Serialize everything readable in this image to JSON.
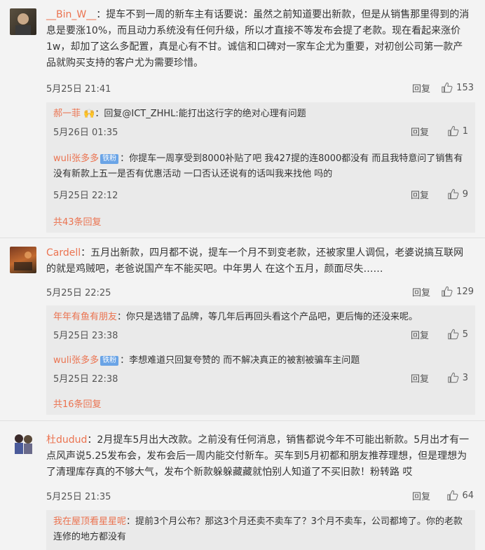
{
  "comments": [
    {
      "user": "__Bin_W__",
      "sep": "：",
      "text": "提车不到一周的新车主有话要说：虽然之前知道要出新款，但是从销售那里得到的消息是要涨10%，而且动力系统没有任何升级，所以才直接不等发布会提了老款。现在看起来涨价1w，却加了这么多配置，真是心有不甘。诚信和口碑对一家车企尤为重要，对初创公司第一款产品就购买支持的客户尤为需要珍惜。",
      "date": "5月25日 21:41",
      "reply_label": "回复",
      "likes": "153",
      "replies": [
        {
          "user": "郝一菲",
          "emoji": "🙌",
          "sep": "：",
          "text": "回复@ICT_ZHHL:能打出这行字的绝对心理有问题",
          "date": "5月26日 01:35",
          "reply_label": "回复",
          "likes": "1"
        },
        {
          "user": "wuli张多多",
          "badge": "铁粉",
          "sep": "：",
          "text": "你提车一周享受到8000补贴了吧 我427提的连8000都没有 而且我特意问了销售有没有新款上五一是否有优惠活动 一口否认还说有的话叫我来找他 吗的",
          "date": "5月25日 22:12",
          "reply_label": "回复",
          "likes": "9"
        }
      ],
      "more": "共43条回复"
    },
    {
      "user": "Cardell",
      "sep": "：",
      "text": "五月出新款，四月都不说，提车一个月不到变老款，还被家里人调侃，老婆说搞互联网的就是鸡贼吧，老爸说国产车不能买吧。中年男人 在这个五月，颜面尽失……",
      "date": "5月25日 22:25",
      "reply_label": "回复",
      "likes": "129",
      "replies": [
        {
          "user": "年年有鱼有朋友",
          "sep": "：",
          "text": "你只是选错了品牌，等几年后再回头看这个产品吧，更后悔的还没来呢。",
          "date": "5月25日 23:38",
          "reply_label": "回复",
          "likes": "5"
        },
        {
          "user": "wuli张多多",
          "badge": "铁粉",
          "sep": "：",
          "text": "李想难道只回复夸赞的 而不解决真正的被割被骗车主问题",
          "date": "5月25日 22:38",
          "reply_label": "回复",
          "likes": "3"
        }
      ],
      "more": "共16条回复"
    },
    {
      "user": "杜dudud",
      "sep": "：",
      "text": "2月提车5月出大改款。之前没有任何消息，销售都说今年不可能出新款。5月出才有一点风声说5.25发布会，发布会后一周内能交付新车。买车到5月初都和朋友推荐理想，但是理想为了清理库存真的不够大气，发布个新款躲躲藏藏就怕别人知道了不买旧款！粉转路 哎",
      "date": "5月25日 21:35",
      "reply_label": "回复",
      "likes": "64",
      "replies": [
        {
          "user": "我在屋顶看星星呢",
          "sep": "：",
          "text": "提前3个月公布？那这3个月还卖不卖车了？3个月不卖车，公司都垮了。你的老款连修的地方都没有"
        }
      ]
    }
  ],
  "colors": {
    "username": "#eb7350",
    "badge": "#6aa4e6",
    "reply_bg": "#eaeaea",
    "page_bg": "#f3f3f3"
  },
  "icons": {
    "like": "thumbs-up-icon"
  }
}
